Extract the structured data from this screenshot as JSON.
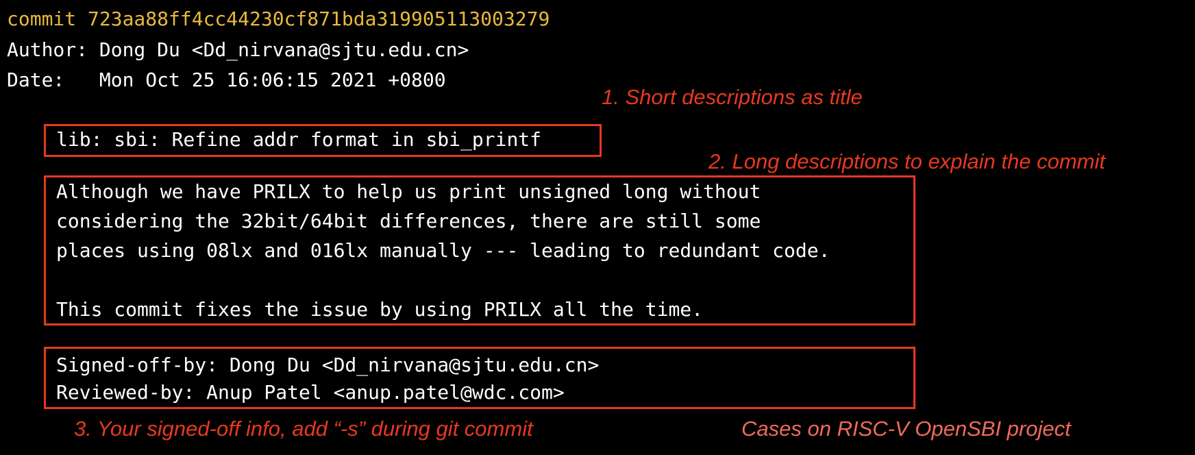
{
  "commit": {
    "hash_line": "commit 723aa88ff4cc44230cf871bda319905113003279",
    "author_line": "Author: Dong Du <Dd_nirvana@sjtu.edu.cn>",
    "date_line": "Date:   Mon Oct 25 16:06:15 2021 +0800",
    "title": "lib: sbi: Refine addr format in sbi_printf",
    "body": "Although we have PRILX to help us print unsigned long without\nconsidering the 32bit/64bit differences, there are still some\nplaces using 08lx and 016lx manually --- leading to redundant code.\n\nThis commit fixes the issue by using PRILX all the time.",
    "trailers": "Signed-off-by: Dong Du <Dd_nirvana@sjtu.edu.cn>\nReviewed-by: Anup Patel <anup.patel@wdc.com>"
  },
  "annotations": {
    "title_note": "1. Short descriptions as title",
    "body_note": "2. Long descriptions to explain the commit",
    "signoff_note": "3. Your signed-off info, add “-s” during git commit",
    "source_note": "Cases on RISC-V OpenSBI project"
  },
  "colors": {
    "background": "#000000",
    "commit_hash": "#e9b93c",
    "terminal_text": "#ffffff",
    "highlight_red": "#e8391f",
    "source_note": "#ef6b5b"
  }
}
